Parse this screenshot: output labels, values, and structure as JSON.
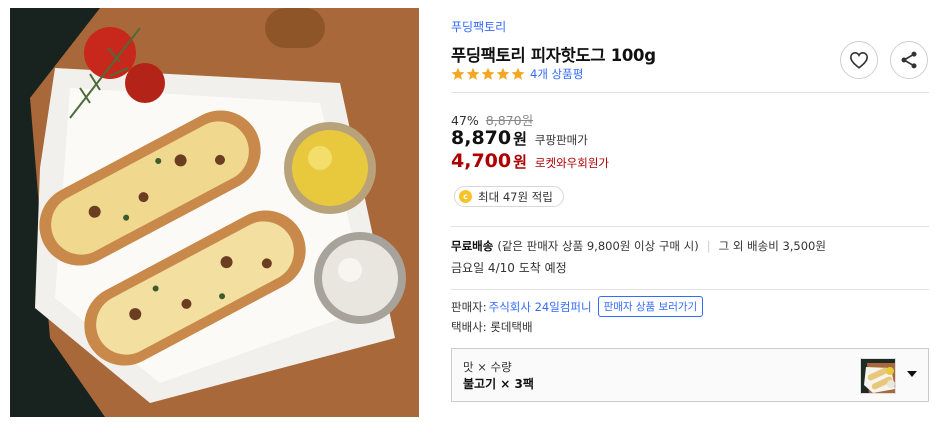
{
  "product": {
    "brand": "푸딩팩토리",
    "title": "푸딩팩토리 피자핫도그 100g",
    "rating_stars": 5,
    "review_count": "4개 상품평"
  },
  "actions": {
    "wishlist_icon": "heart-icon",
    "share_icon": "share-icon"
  },
  "pricing": {
    "discount_rate": "47%",
    "original_price": "8,870원",
    "coupang_price": "8,870",
    "coupang_unit": "원",
    "coupang_label": "쿠팡판매가",
    "rocket_price": "4,700",
    "rocket_unit": "원",
    "rocket_label": "로켓와우회원가",
    "cash_badge_letter": "c",
    "cash_text": "최대 47원 적립"
  },
  "shipping": {
    "free_label": "무료배송",
    "condition": "(같은 판매자 상품 9,800원 이상 구매 시)",
    "other_fee": "그 외 배송비 3,500원",
    "arrival": "금요일 4/10 도착 예정"
  },
  "seller": {
    "label": "판매자:",
    "name": "주식회사 24일컴퍼니",
    "view_products_button": "판매자 상품 보러가기",
    "courier": "택배사: 롯데택배"
  },
  "option": {
    "label": "맛 × 수량",
    "value": "불고기 × 3팩",
    "dropdown_icon": "caret-down-icon"
  },
  "colors": {
    "link_blue": "#346aff",
    "price_red": "#ae0000",
    "star_orange": "#f5a623",
    "coin_yellow": "#f6c32a"
  }
}
